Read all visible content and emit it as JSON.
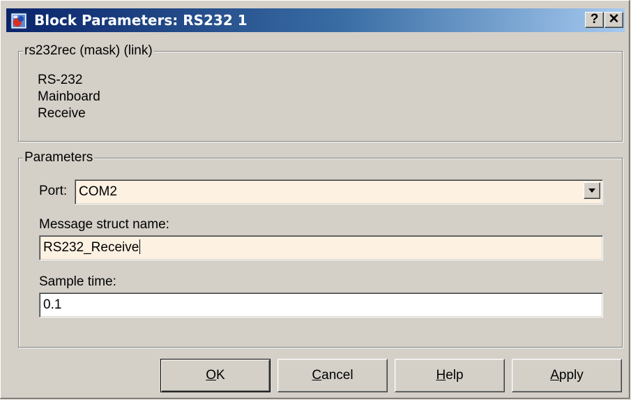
{
  "window": {
    "title": "Block Parameters: RS232 1",
    "help_glyph": "?",
    "close_glyph": "✕"
  },
  "mask_group": {
    "legend": "rs232rec (mask) (link)",
    "description_lines": [
      "RS-232",
      "Mainboard",
      "Receive"
    ]
  },
  "params_group": {
    "legend": "Parameters",
    "port": {
      "label": "Port:",
      "value": "COM2"
    },
    "message_struct_name": {
      "label": "Message struct name:",
      "value": "RS232_Receive"
    },
    "sample_time": {
      "label": "Sample time:",
      "value": "0.1"
    }
  },
  "buttons": {
    "ok": {
      "mnemonic": "O",
      "rest": "K"
    },
    "cancel": {
      "mnemonic": "C",
      "rest": "ancel"
    },
    "help": {
      "mnemonic": "H",
      "rest": "elp"
    },
    "apply": {
      "mnemonic": "A",
      "rest": "pply"
    }
  },
  "colors": {
    "titlebar_start": "#0a246a",
    "titlebar_end": "#a6caf0",
    "field_highlight": "#fdf1e2",
    "dialog_face": "#d4d0c8"
  }
}
